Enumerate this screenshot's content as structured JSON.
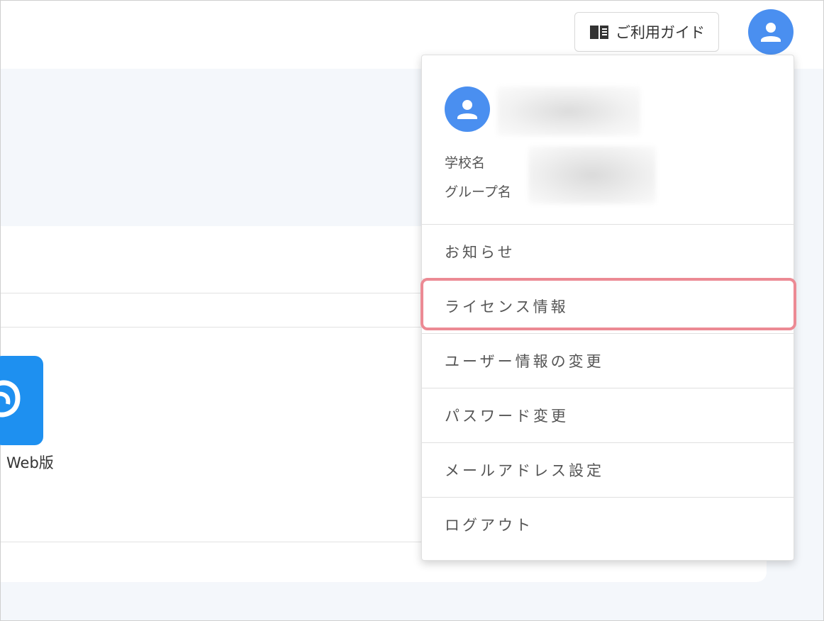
{
  "header": {
    "guide_label": "ご利用ガイド",
    "guide_icon": "book-icon",
    "avatar_icon": "user-icon"
  },
  "main": {
    "app_label": "Web版",
    "app_icon": "app-icon"
  },
  "user_menu": {
    "profile": {
      "school_label": "学校名",
      "group_label": "グループ名"
    },
    "items": [
      {
        "label": "お知らせ"
      },
      {
        "label": "ライセンス情報"
      },
      {
        "label": "ユーザー情報の変更"
      },
      {
        "label": "パスワード変更"
      },
      {
        "label": "メールアドレス設定"
      },
      {
        "label": "ログアウト"
      }
    ]
  },
  "colors": {
    "accent": "#4a8ff0",
    "highlight": "#ec8a94",
    "app_tile": "#1e90f0"
  }
}
